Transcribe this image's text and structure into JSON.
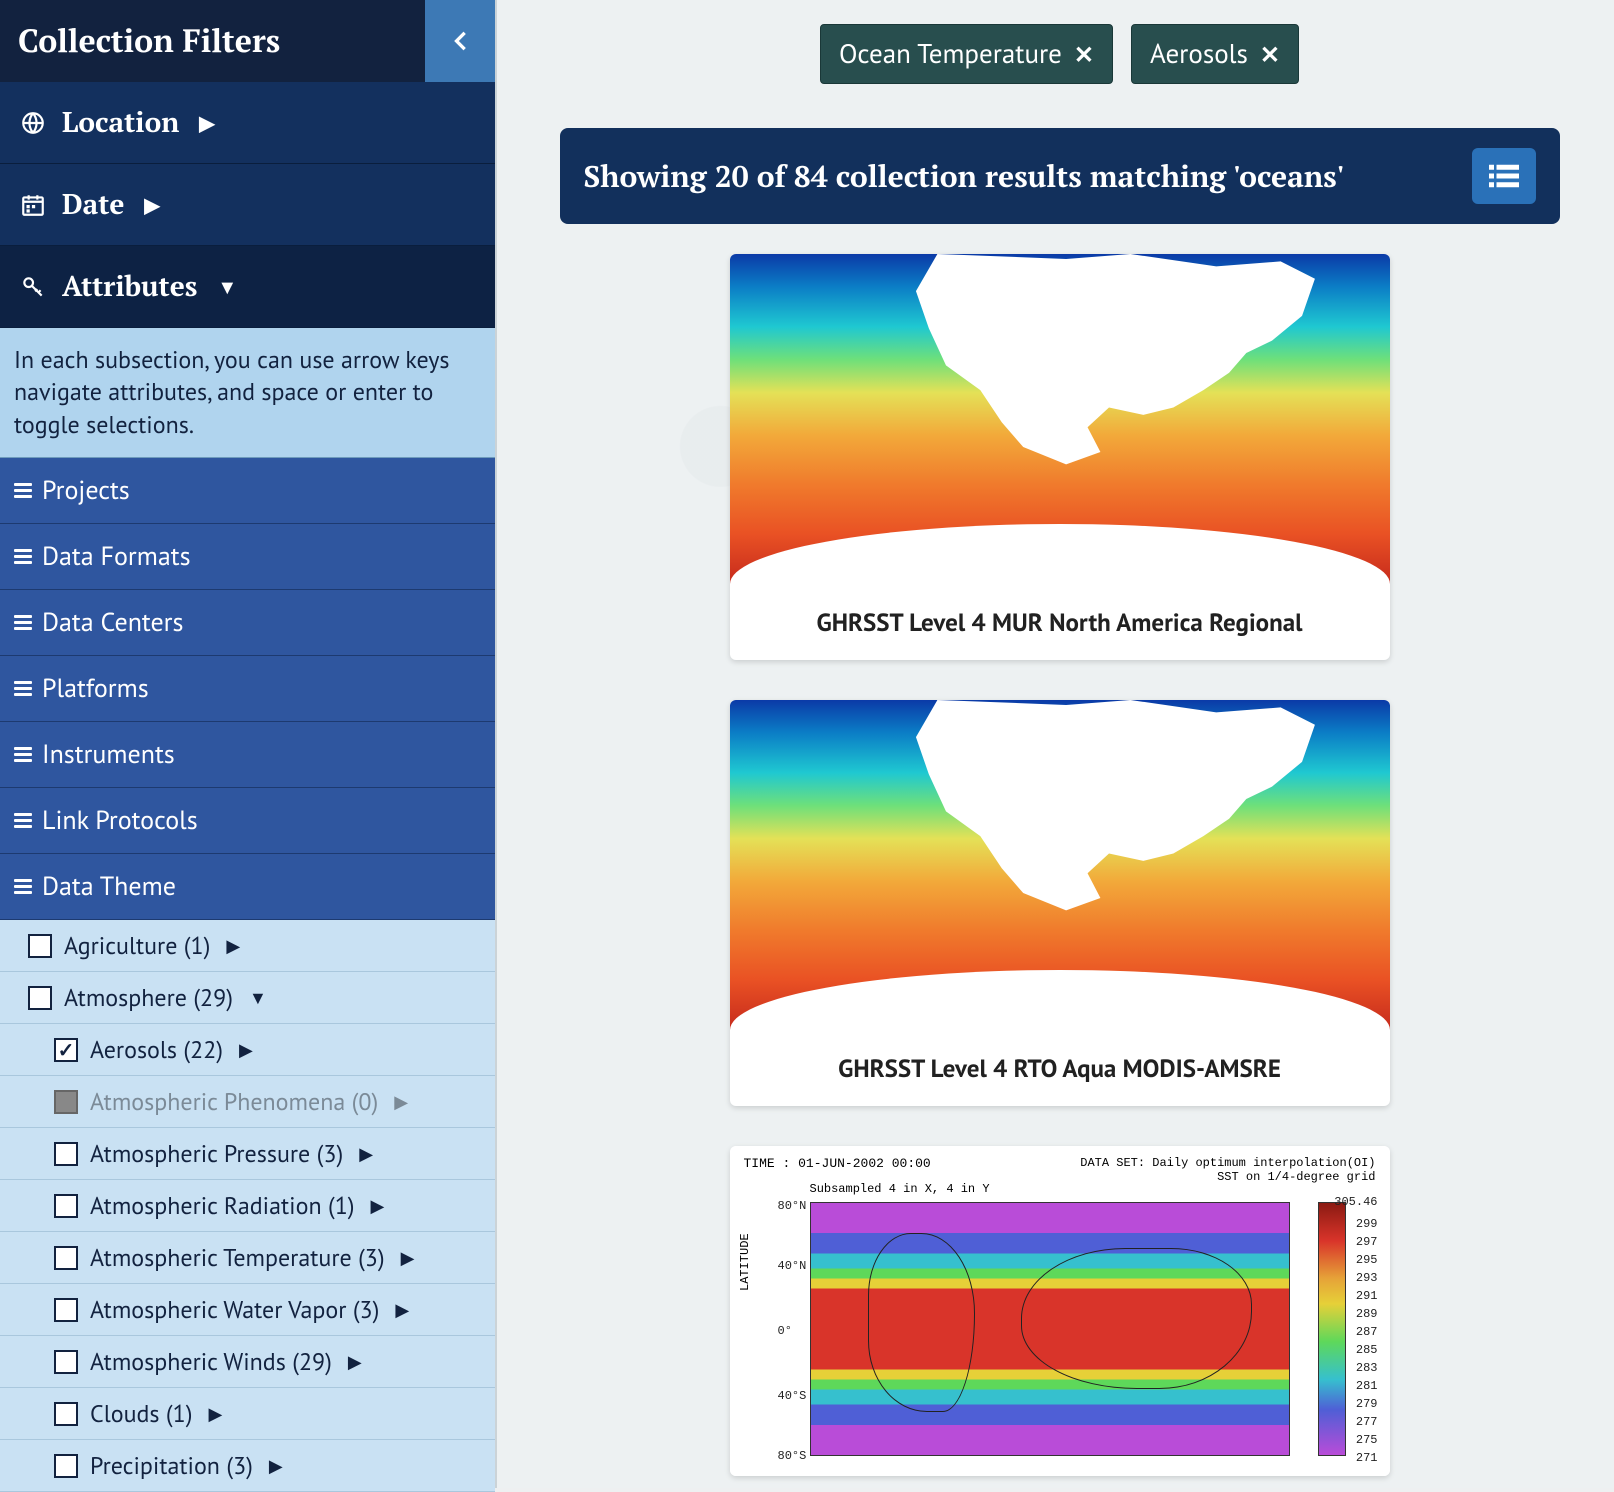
{
  "sidebar": {
    "title": "Collection Filters",
    "location_label": "Location",
    "date_label": "Date",
    "attributes_label": "Attributes",
    "info_text": "In each subsection, you can use arrow keys navigate attributes, and space or enter to toggle selections.",
    "subsections": {
      "projects": "Projects",
      "data_formats": "Data Formats",
      "data_centers": "Data Centers",
      "platforms": "Platforms",
      "instruments": "Instruments",
      "link_protocols": "Link Protocols",
      "data_theme": "Data Theme"
    },
    "tree": {
      "agriculture": {
        "label": "Agriculture (1)",
        "checked": false,
        "expanded": false
      },
      "atmosphere": {
        "label": "Atmosphere (29)",
        "checked": false,
        "expanded": true
      },
      "aerosols": {
        "label": "Aerosols (22)",
        "checked": true,
        "expanded": false
      },
      "atm_phenomena": {
        "label": "Atmospheric Phenomena (0)",
        "checked": false,
        "disabled": true,
        "expanded": false
      },
      "atm_pressure": {
        "label": "Atmospheric Pressure (3)",
        "checked": false,
        "expanded": false
      },
      "atm_radiation": {
        "label": "Atmospheric Radiation (1)",
        "checked": false,
        "expanded": false
      },
      "atm_temperature": {
        "label": "Atmospheric Temperature (3)",
        "checked": false,
        "expanded": false
      },
      "atm_water_vapor": {
        "label": "Atmospheric Water Vapor (3)",
        "checked": false,
        "expanded": false
      },
      "atm_winds": {
        "label": "Atmospheric Winds (29)",
        "checked": false,
        "expanded": false
      },
      "clouds": {
        "label": "Clouds (1)",
        "checked": false,
        "expanded": false
      },
      "precipitation": {
        "label": "Precipitation (3)",
        "checked": false,
        "expanded": false
      }
    }
  },
  "tags": {
    "ocean_temperature": "Ocean Temperature",
    "aerosols": "Aerosols"
  },
  "results": {
    "shown": 20,
    "total": 84,
    "query": "oceans",
    "heading": "Showing 20 of 84 collection results matching 'oceans'"
  },
  "cards": {
    "card1_title": "GHRSST Level 4 MUR North America Regional",
    "card2_title": "GHRSST Level 4 RTO Aqua MODIS-AMSRE"
  },
  "global_plot": {
    "time_label": "TIME : 01-JUN-2002 00:00",
    "dataset_label_1": "DATA SET: Daily optimum interpolation(OI)",
    "dataset_label_2": "SST on 1/4-degree grid",
    "subsample_label": "Subsampled 4 in X, 4 in Y",
    "yaxis_label": "LATITUDE",
    "yticks": [
      "80°N",
      "40°N",
      "0°",
      "40°S",
      "80°S"
    ],
    "cbticks": [
      "305.46",
      "299",
      "297",
      "295",
      "293",
      "291",
      "289",
      "287",
      "285",
      "283",
      "281",
      "279",
      "277",
      "275",
      "271"
    ]
  }
}
